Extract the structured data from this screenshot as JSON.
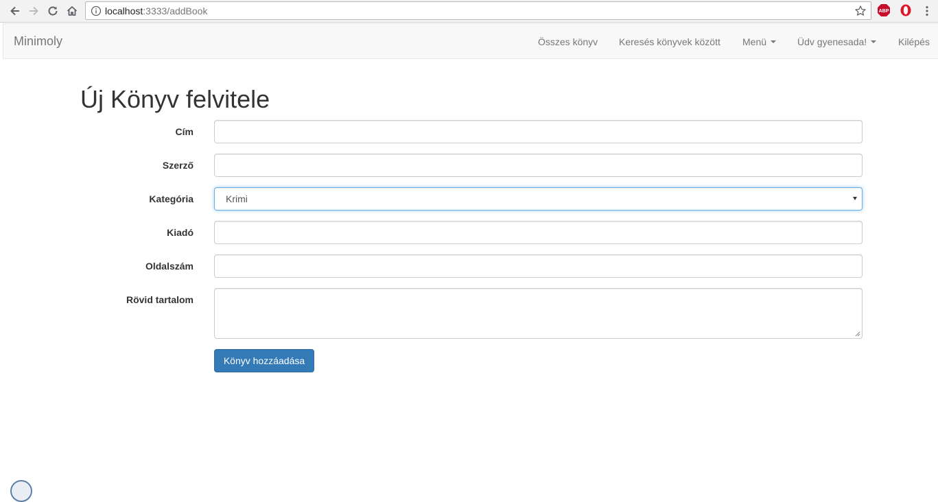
{
  "browser": {
    "url_host": "localhost",
    "url_rest": ":3333/addBook",
    "icons": [
      "back-icon",
      "forward-icon",
      "reload-icon",
      "home-icon",
      "info-icon",
      "star-icon",
      "adblock-plus-icon",
      "opera-icon"
    ],
    "abp_label": "ABP"
  },
  "navbar": {
    "brand": "Minimoly",
    "links": {
      "all_books": "Összes könyv",
      "search": "Keresés könyvek között",
      "menu": "Menü",
      "user": "Üdv gyenesada!",
      "logout": "Kilépés"
    }
  },
  "form": {
    "title": "Új Könyv felvitele",
    "fields": {
      "title_label": "Cím",
      "author_label": "Szerző",
      "category_label": "Kategória",
      "category_value": "Krimi",
      "publisher_label": "Kiadó",
      "pages_label": "Oldalszám",
      "summary_label": "Rövid tartalom"
    },
    "submit_label": "Könyv hozzáadása"
  },
  "colors": {
    "primary": "#337ab7",
    "navbar_bg": "#f8f8f8",
    "focus_border": "#66afe9"
  }
}
